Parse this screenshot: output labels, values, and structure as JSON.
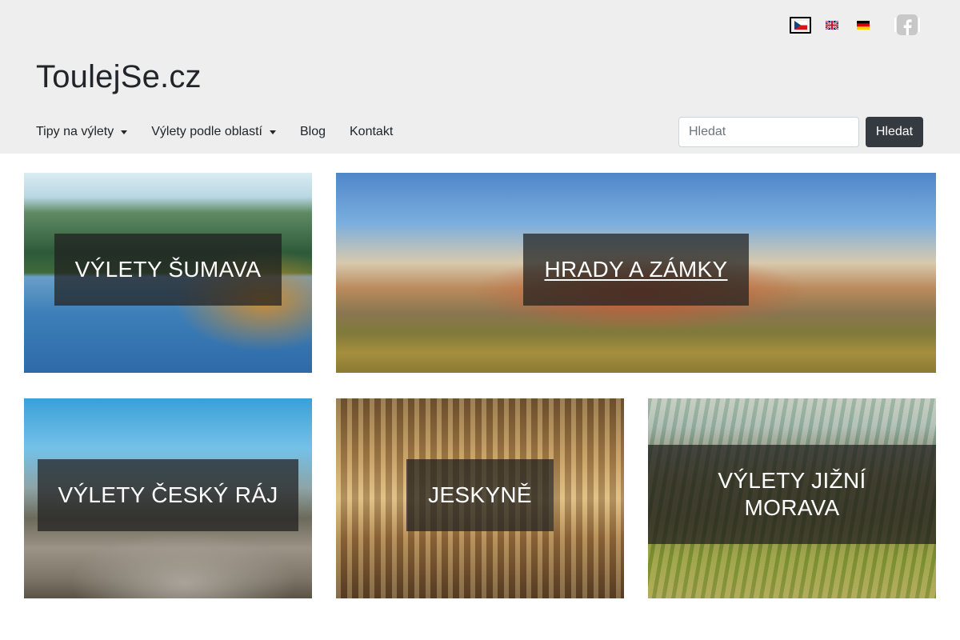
{
  "site": {
    "brand": "ToulejSe.cz"
  },
  "languages": [
    {
      "name": "cz-flag-icon",
      "active": true
    },
    {
      "name": "gb-flag-icon",
      "active": false
    },
    {
      "name": "de-flag-icon",
      "active": false
    }
  ],
  "nav": {
    "items": [
      {
        "label": "Tipy na výlety",
        "dropdown": true
      },
      {
        "label": "Výlety podle oblastí",
        "dropdown": true
      },
      {
        "label": "Blog",
        "dropdown": false
      },
      {
        "label": "Kontakt",
        "dropdown": false
      }
    ]
  },
  "search": {
    "placeholder": "Hledat",
    "value": "",
    "button_label": "Hledat"
  },
  "tiles": [
    {
      "title": "VÝLETY ŠUMAVA"
    },
    {
      "title": "HRADY A ZÁMKY"
    },
    {
      "title": "VÝLETY ČESKÝ RÁJ"
    },
    {
      "title": "JESKYNĚ"
    },
    {
      "title": "VÝLETY JIŽNÍ MORAVA"
    }
  ],
  "colors": {
    "header_bg": "#eeeeee",
    "button_dark": "#343a40",
    "caption_bg": "rgba(30,30,30,0.72)"
  }
}
